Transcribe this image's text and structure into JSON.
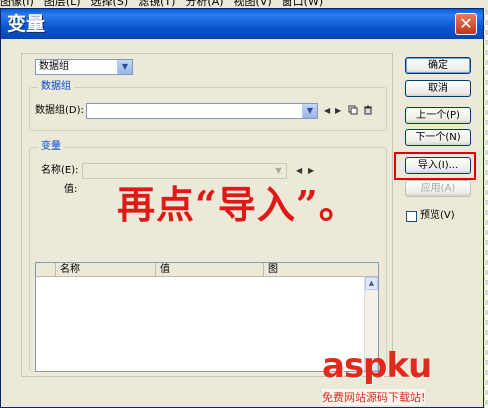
{
  "menu": [
    "图像(I)",
    "图层(L)",
    "选择(S)",
    "滤镜(T)",
    "分析(A)",
    "视图(V)",
    "窗口(W)"
  ],
  "dialog": {
    "title": "变量",
    "close_glyph": "✕",
    "top_select_value": "数据组",
    "dataset_group": {
      "legend": "数据组",
      "label": "数据组(D):",
      "value": ""
    },
    "variable_group": {
      "legend": "变量",
      "name_label": "名称(E):",
      "name_value": "",
      "value_label": "值:"
    },
    "table": {
      "columns": [
        "名称",
        "值",
        "图"
      ]
    },
    "buttons": {
      "ok": "确定",
      "cancel": "取消",
      "prev": "上一个(P)",
      "next": "下一个(N)",
      "import": "导入(I)...",
      "apply": "应用(A)"
    },
    "preview_label": "预览(V)"
  },
  "annotation": "再点“导入”。",
  "watermark": {
    "brand": "aspku",
    "sub": "免费网站源码下载站!"
  },
  "colors": {
    "highlight": "#e10000",
    "annotation": "#e01818",
    "titlebar": "#0a56d0"
  }
}
